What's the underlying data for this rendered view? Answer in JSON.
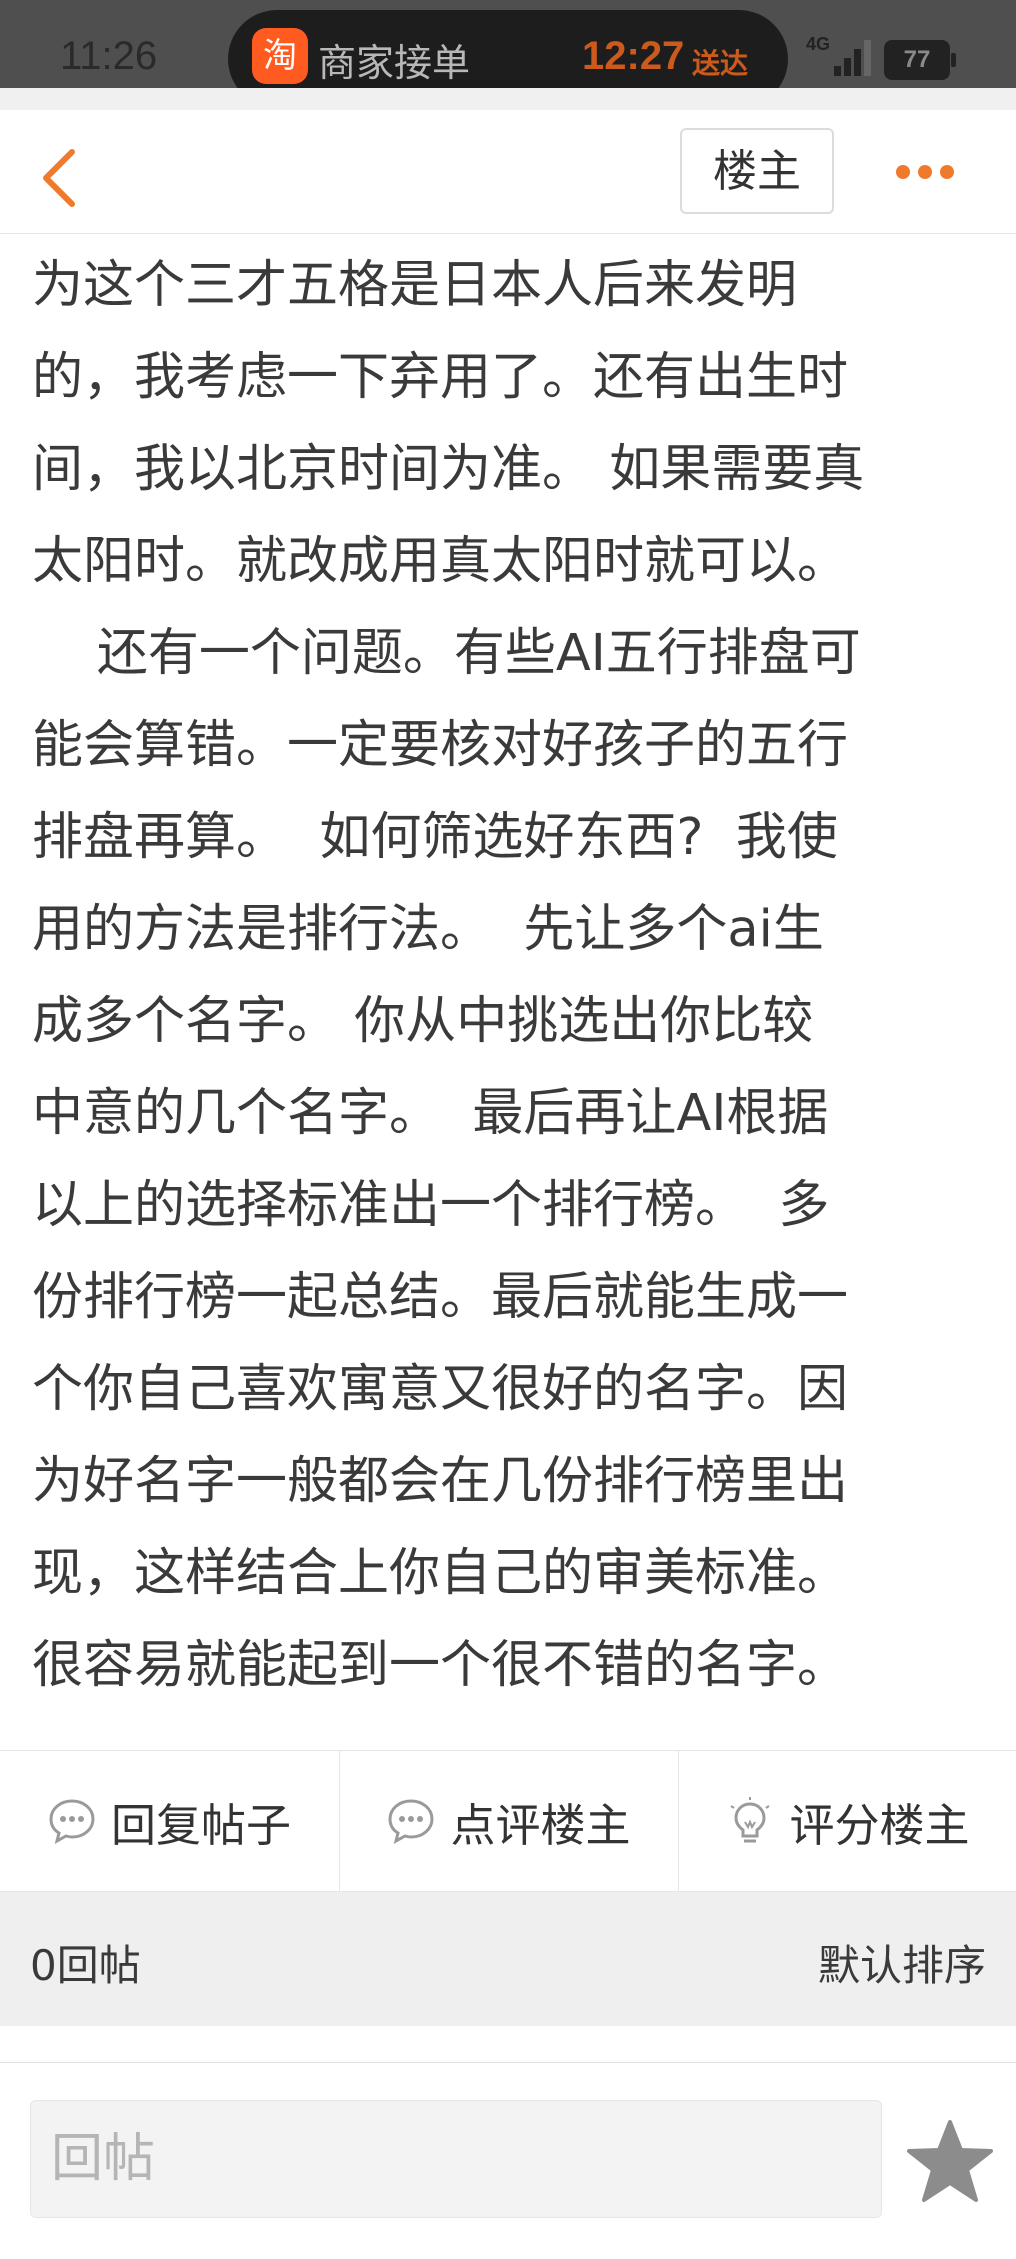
{
  "status_bar": {
    "time": "11:26",
    "live_activity": {
      "app_glyph": "淘",
      "title": "商家接单",
      "eta_time": "12:27",
      "eta_label": "送达"
    },
    "network": "4G",
    "battery": "77"
  },
  "nav": {
    "owner_label": "楼主"
  },
  "post": {
    "lines": [
      "为这个三才五格是日本人后来发明",
      "的，我考虑一下弃用了。还有出生时",
      "间，我以北京时间为准。 如果需要真",
      "太阳时。就改成用真太阳时就可以。",
      "    还有一个问题。有些AI五行排盘可",
      "能会算错。一定要核对好孩子的五行",
      "排盘再算。  如何筛选好东西?  我使",
      "用的方法是排行法。  先让多个ai生",
      "成多个名字。 你从中挑选出你比较",
      "中意的几个名字。  最后再让AI根据",
      "以上的选择标准出一个排行榜。  多",
      "份排行榜一起总结。最后就能生成一",
      "个你自己喜欢寓意又很好的名字。因",
      "为好名字一般都会在几份排行榜里出",
      "现，这样结合上你自己的审美标准。",
      "很容易就能起到一个很不错的名字。"
    ]
  },
  "actions": {
    "reply_post": "回复帖子",
    "comment_owner": "点评楼主",
    "rate_owner": "评分楼主"
  },
  "replies": {
    "count_label": "0回帖",
    "sort_label": "默认排序"
  },
  "compose": {
    "placeholder": "回帖"
  },
  "colors": {
    "accent": "#f07a2c",
    "pill_accent": "#cc5a1c",
    "status_bg": "#4f4f4f"
  }
}
